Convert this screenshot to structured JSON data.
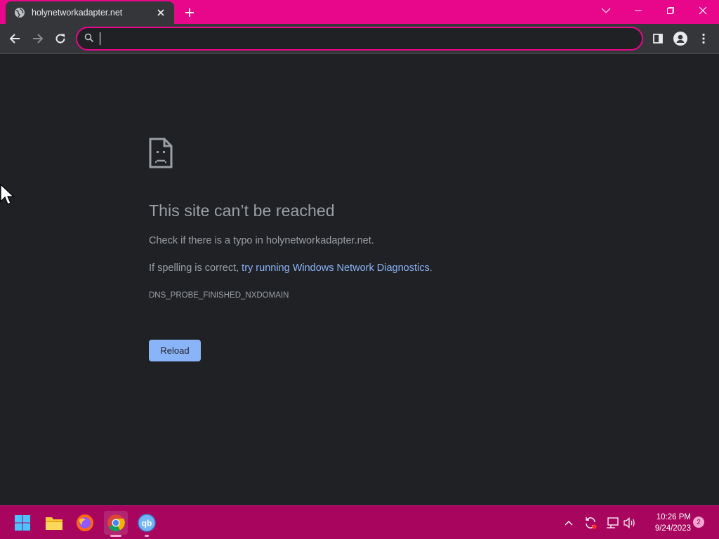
{
  "browser": {
    "tab": {
      "title": "holynetworkadapter.net",
      "favicon": "globe-icon"
    },
    "omnibox": {
      "value": "",
      "placeholder": ""
    },
    "accent_color": "#e8068a"
  },
  "error_page": {
    "heading": "This site can’t be reached",
    "line1": "Check if there is a typo in holynetworkadapter.net.",
    "line2_prefix": "If spelling is correct, ",
    "line2_link": "try running Windows Network Diagnostics",
    "line2_suffix": ".",
    "error_code": "DNS_PROBE_FINISHED_NXDOMAIN",
    "reload_label": "Reload",
    "link_color": "#8ab4f8"
  },
  "taskbar": {
    "apps": [
      "start-icon",
      "file-explorer-icon",
      "firefox-icon",
      "chrome-icon",
      "qbittorrent-icon"
    ],
    "time": "10:26 PM",
    "date": "9/24/2023",
    "notification_count": "2"
  }
}
